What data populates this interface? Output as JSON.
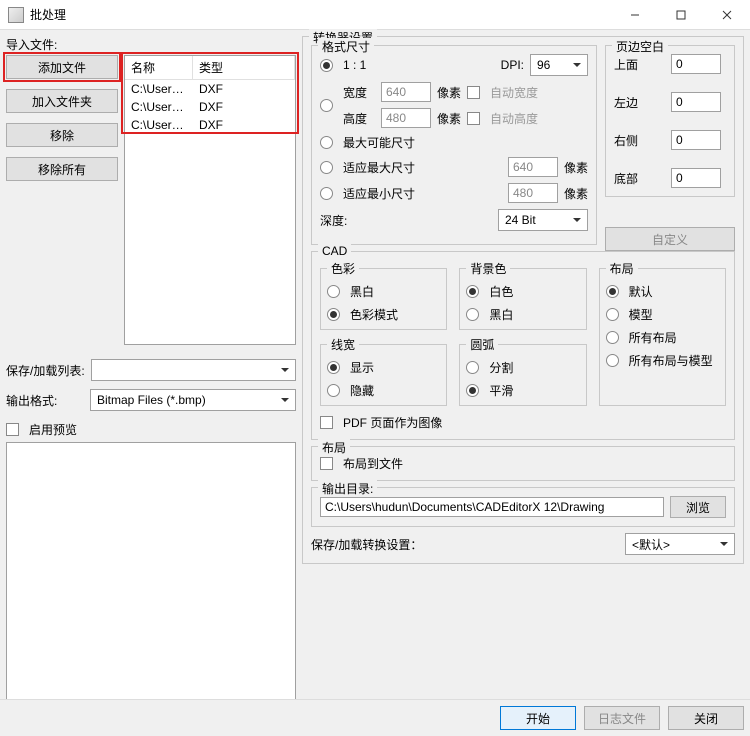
{
  "window": {
    "title": "批处理"
  },
  "left": {
    "import_label": "导入文件:",
    "buttons": {
      "add_file": "添加文件",
      "add_folder": "加入文件夹",
      "remove": "移除",
      "remove_all": "移除所有"
    },
    "columns": {
      "name": "名称",
      "type": "类型"
    },
    "files": [
      {
        "name": "C:\\Users\\...",
        "type": "DXF"
      },
      {
        "name": "C:\\Users\\...",
        "type": "DXF"
      },
      {
        "name": "C:\\Users\\...",
        "type": "DXF"
      }
    ],
    "save_load_list": "保存/加载列表:",
    "output_format_label": "输出格式:",
    "output_format_value": "Bitmap Files (*.bmp)",
    "enable_preview": "启用预览"
  },
  "converter": {
    "title": "转换器设置",
    "format_size": {
      "title": "格式尺寸",
      "one_to_one": "1 : 1",
      "dpi_label": "DPI:",
      "dpi_value": "96",
      "width_label": "宽度",
      "width_value": "640",
      "pixel": "像素",
      "auto_width": "自动宽度",
      "height_label": "高度",
      "height_value": "480",
      "auto_height": "自动高度",
      "max_possible": "最大可能尺寸",
      "fit_max": "适应最大尺寸",
      "fit_max_value": "640",
      "fit_min": "适应最小尺寸",
      "fit_min_value": "480",
      "depth_label": "深度:",
      "depth_value": "24 Bit"
    },
    "margins": {
      "title": "页边空白",
      "top": "上面",
      "top_v": "0",
      "left": "左边",
      "left_v": "0",
      "right": "右侧",
      "right_v": "0",
      "bottom": "底部",
      "bottom_v": "0",
      "custom": "自定义"
    },
    "cad": {
      "title": "CAD",
      "color": {
        "title": "色彩",
        "bw": "黑白",
        "color_mode": "色彩模式"
      },
      "bg": {
        "title": "背景色",
        "white": "白色",
        "black": "黑白"
      },
      "layout": {
        "title": "布局",
        "default": "默认",
        "model": "模型",
        "all": "所有布局",
        "all_model": "所有布局与模型"
      },
      "linew": {
        "title": "线宽",
        "show": "显示",
        "hide": "隐藏"
      },
      "arc": {
        "title": "圆弧",
        "split": "分割",
        "smooth": "平滑"
      },
      "pdf_as_image": "PDF 页面作为图像"
    },
    "layout2": {
      "title": "布局",
      "to_file": "布局到文件"
    },
    "output_dir": {
      "label": "输出目录:",
      "value": "C:\\Users\\hudun\\Documents\\CADEditorX 12\\Drawing",
      "browse": "浏览"
    },
    "save_load_conv": {
      "label": "保存/加载转换设置：",
      "value": "<默认>"
    }
  },
  "footer": {
    "start": "开始",
    "log": "日志文件",
    "close": "关闭"
  }
}
